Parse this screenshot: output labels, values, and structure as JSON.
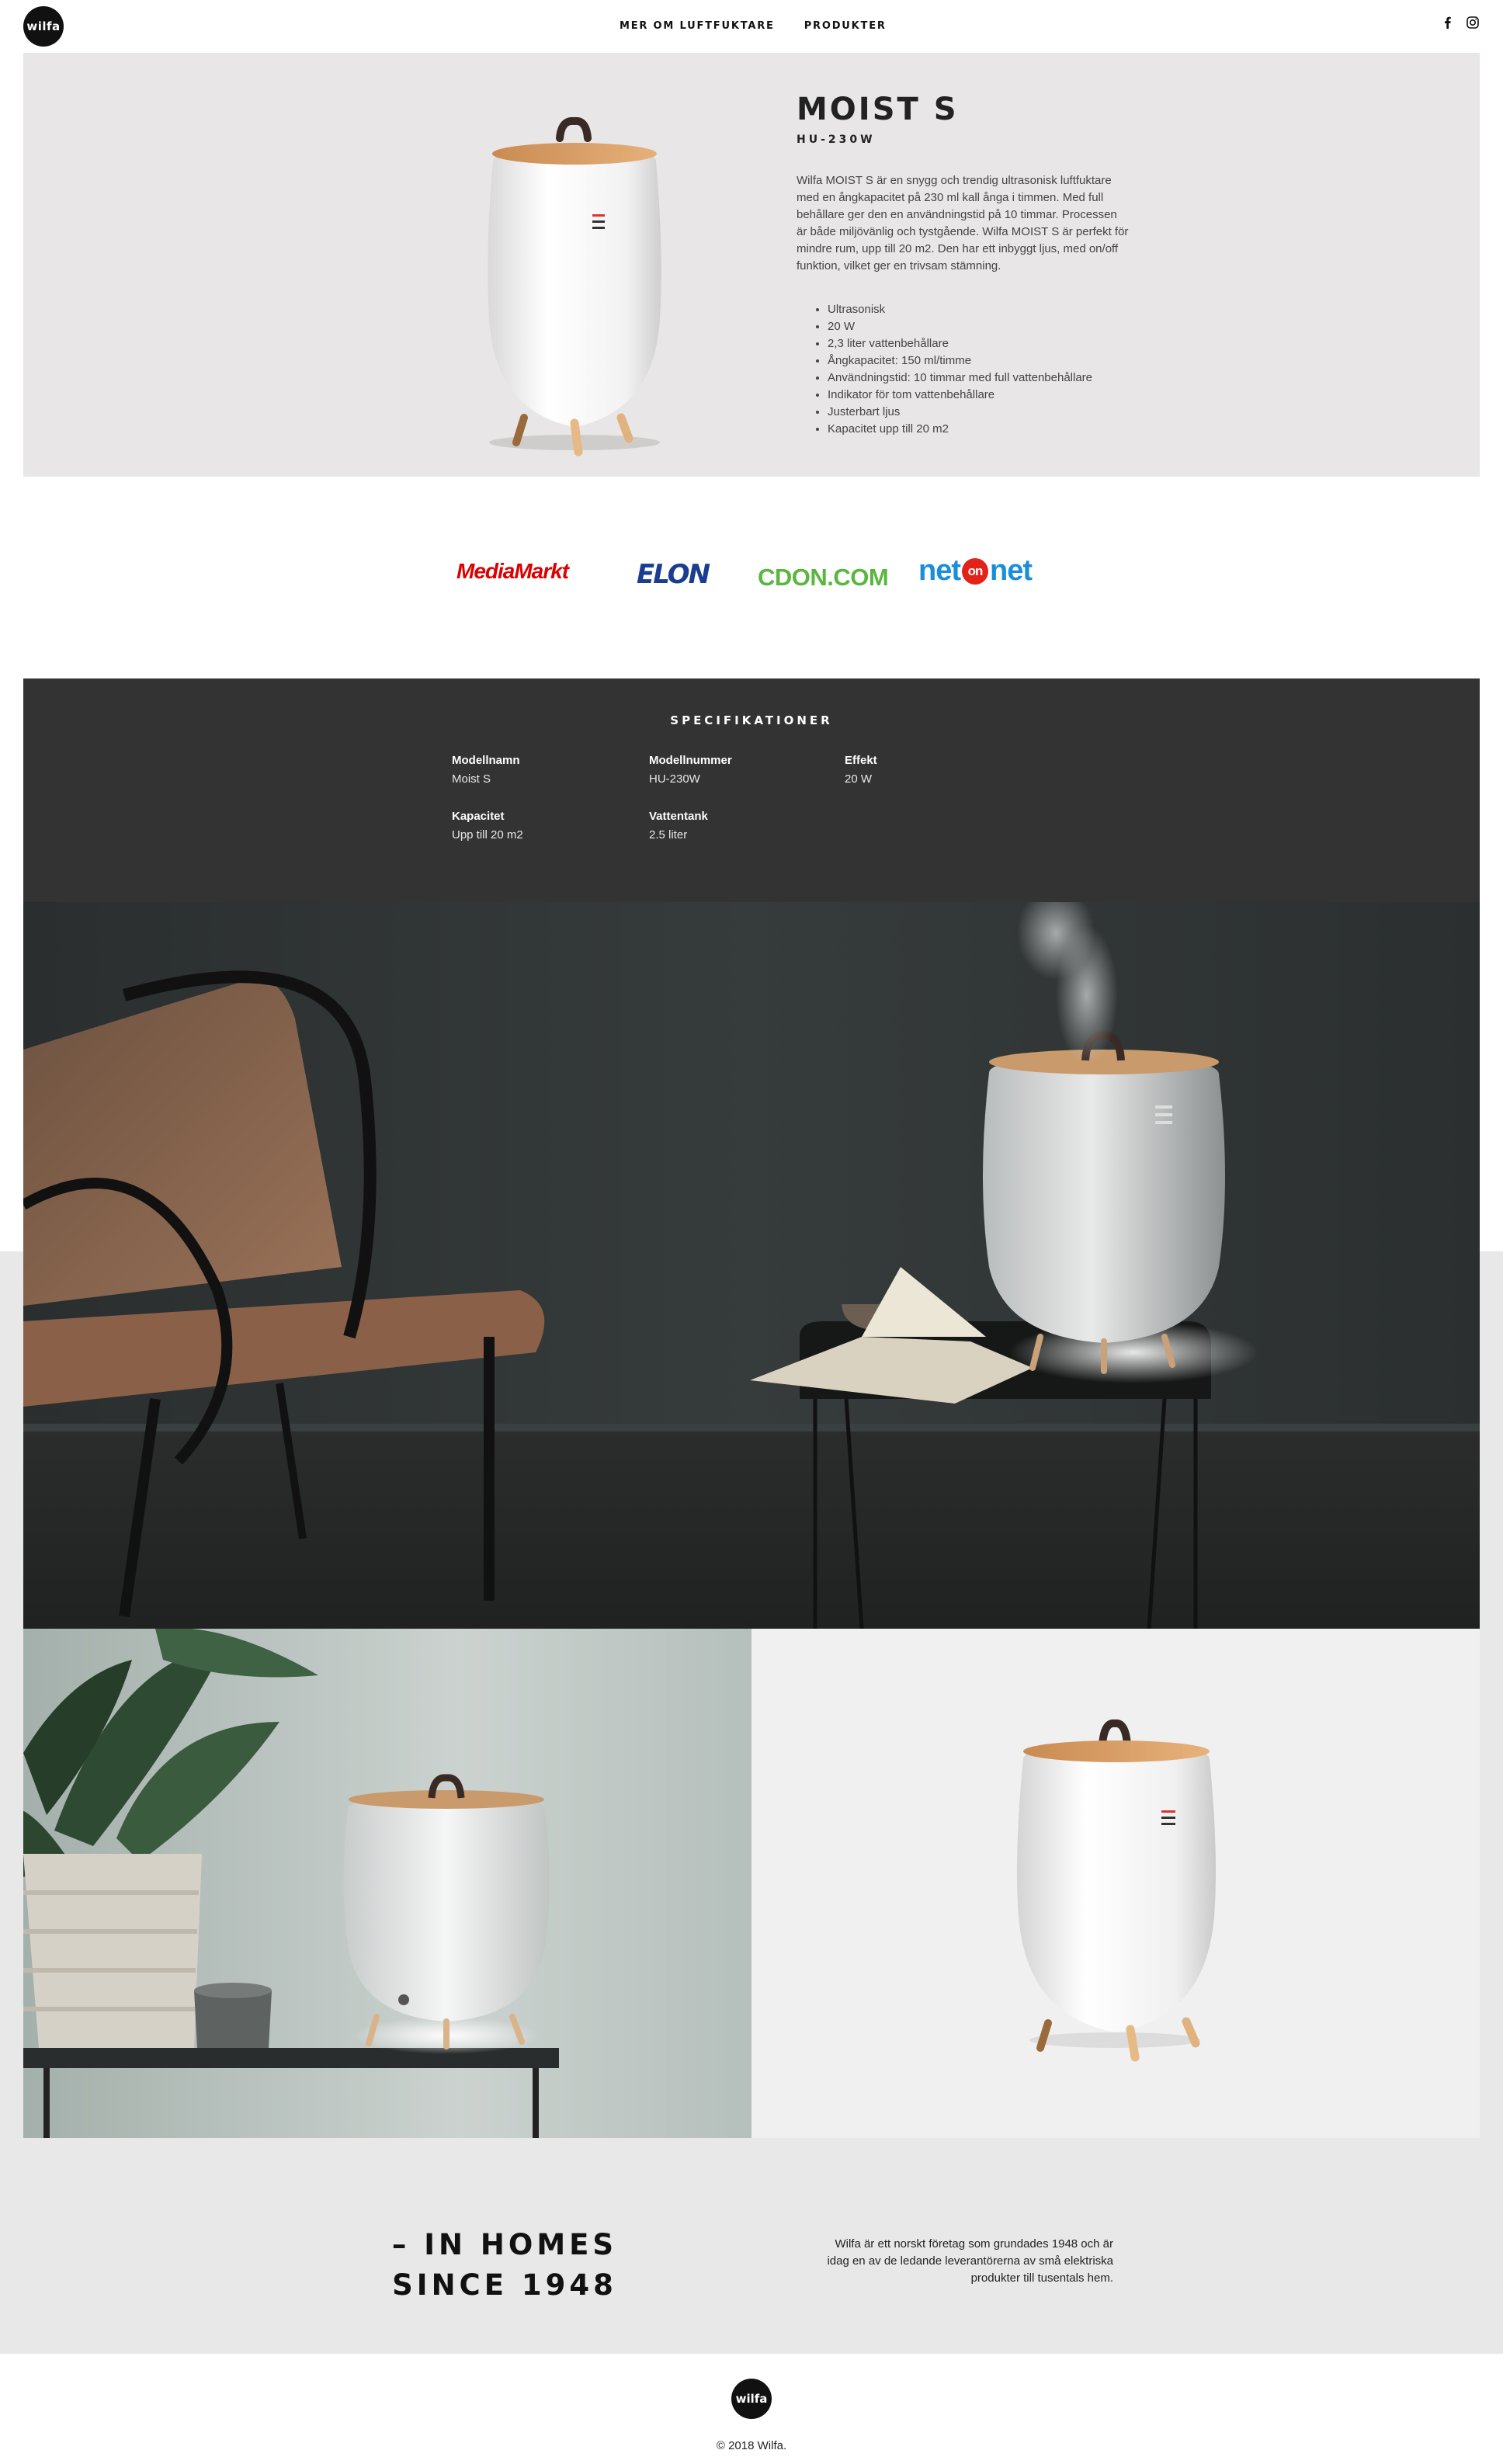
{
  "brand": {
    "logo_text": "wilfa"
  },
  "nav": {
    "items": [
      "MER OM LUFTFUKTARE",
      "PRODUKTER"
    ]
  },
  "social": {
    "icons": [
      "facebook-icon",
      "instagram-icon"
    ]
  },
  "product": {
    "title": "MOIST S",
    "model": "HU-230W",
    "description": "Wilfa MOIST S är en snygg och trendig ultrasonisk luftfuktare med en ångkapacitet på 230 ml kall ånga i timmen. Med full behållare ger den en användningstid på 10 timmar. Processen är både miljövänlig och tystgående. Wilfa MOIST S är perfekt för mindre rum, upp till 20 m2. Den har ett inbyggt ljus, med on/off funktion, vilket ger en trivsam stämning.",
    "features": [
      "Ultrasonisk",
      "20 W",
      "2,3 liter vattenbehållare",
      "Ångkapacitet: 150 ml/timme",
      "Användningstid: 10 timmar med full vattenbehållare",
      "Indikator för tom vattenbehållare",
      "Justerbart ljus",
      "Kapacitet upp till 20 m2"
    ]
  },
  "retailers": {
    "mediamarkt": "MediaMarkt",
    "elon": "ELON",
    "cdon": "CDON.COM",
    "netonnet_a": "net",
    "netonnet_on": "on",
    "netonnet_b": "net"
  },
  "specs": {
    "title": "SPECIFIKATIONER",
    "items": [
      {
        "label": "Modellnamn",
        "value": "Moist S"
      },
      {
        "label": "Modellnummer",
        "value": "HU-230W"
      },
      {
        "label": "Effekt",
        "value": "20 W"
      },
      {
        "label": "Kapacitet",
        "value": "Upp till 20 m2"
      },
      {
        "label": "Vattentank",
        "value": "2.5 liter"
      }
    ]
  },
  "tagline": {
    "line1": "– IN HOMES",
    "line2": "SINCE 1948"
  },
  "about": "Wilfa är ett norskt företag som grundades 1948 och är idag en av de ledande leverantörerna av små elektriska produkter till tusentals hem.",
  "footer": {
    "logo_text": "wilfa",
    "copyright": "© 2018 Wilfa."
  },
  "colors": {
    "hero_bg": "#e8e6e6",
    "specs_bg": "#333333",
    "dark_text": "#222222",
    "mediamarkt_red": "#dd0000",
    "cdon_green": "#5ab63f",
    "netonnet_blue": "#1a8fd8"
  }
}
